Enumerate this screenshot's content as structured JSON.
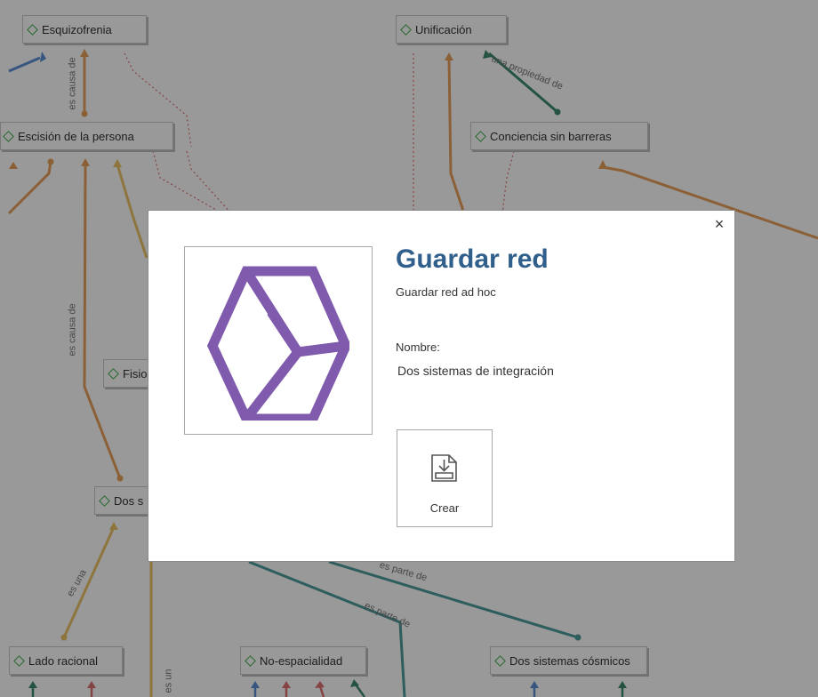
{
  "map": {
    "nodes": {
      "esquizofrenia": "Esquizofrenia",
      "unificacion": "Unificación",
      "escision": "Escisión de la persona",
      "conciencia": "Conciencia sin barreras",
      "fisio": "Fisio",
      "dos_s": "Dos s",
      "lado_racional": "Lado racional",
      "no_espacialidad": "No-espacialidad",
      "dos_sistemas_cosmicos": "Dos sistemas cósmicos"
    },
    "links": {
      "es_causa_de_1": "es causa de",
      "es_causa_de_2": "es causa de",
      "una_propiedad_de": "una propiedad de",
      "es_una": "es una",
      "es_parte_de_1": "es parte de",
      "es_parte_de_2": "es parte de",
      "es_un": "es un"
    },
    "colors": {
      "blue": "#5b8fd6",
      "orange": "#e8a15a",
      "yellow": "#ecc466",
      "teal": "#4d9b9b",
      "green": "#3f8a6d",
      "red": "#e07070"
    }
  },
  "dialog": {
    "title": "Guardar red",
    "subtitle": "Guardar red ad hoc",
    "name_label": "Nombre:",
    "name_value": "Dos sistemas de integración",
    "create_label": "Crear",
    "close_glyph": "×",
    "logo_icon": "network-cube-icon",
    "logo_color": "#7f5aad",
    "create_icon": "save-download-icon"
  }
}
